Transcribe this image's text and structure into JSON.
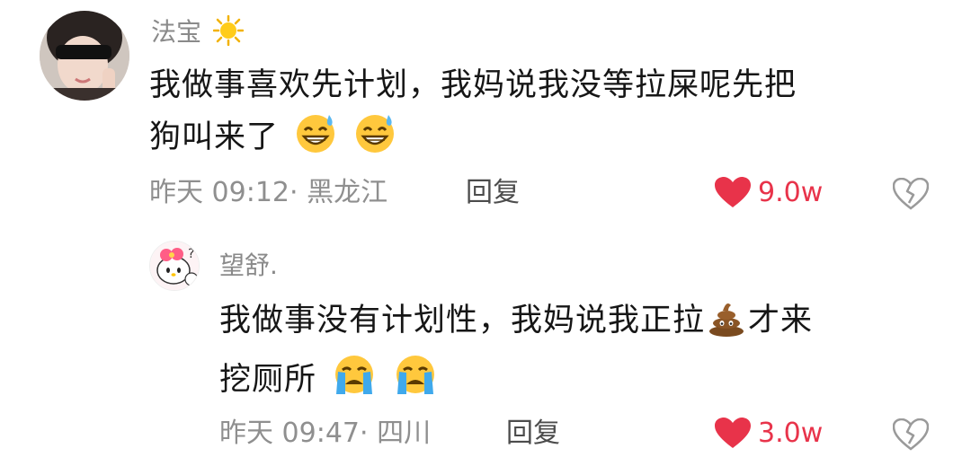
{
  "comments": [
    {
      "username": "法宝",
      "text_line1": "我做事喜欢先计划，我妈说我没等拉屎呢先把",
      "text_line2": "狗叫来了",
      "time": "昨天 09:12",
      "location": "· 黑龙江",
      "reply_label": "回复",
      "likes": "9.0w",
      "username_icon": "sun-emoji",
      "trailing_emojis": [
        "grinning-sweat-emoji",
        "grinning-sweat-emoji"
      ]
    },
    {
      "username": "望舒.",
      "text_line1": "我做事没有计划性，我妈说我正拉",
      "text_line1_tail": "才来",
      "text_line2": "挖厕所",
      "time": "昨天 09:47",
      "location": "· 四川",
      "reply_label": "回复",
      "likes": "3.0w",
      "inline_emoji": "poop-emoji",
      "trailing_emojis": [
        "crying-emoji",
        "crying-emoji"
      ]
    }
  ],
  "colors": {
    "like_red": "#e8334a",
    "meta_gray": "#8f8f8f",
    "text_dark": "#161616"
  }
}
